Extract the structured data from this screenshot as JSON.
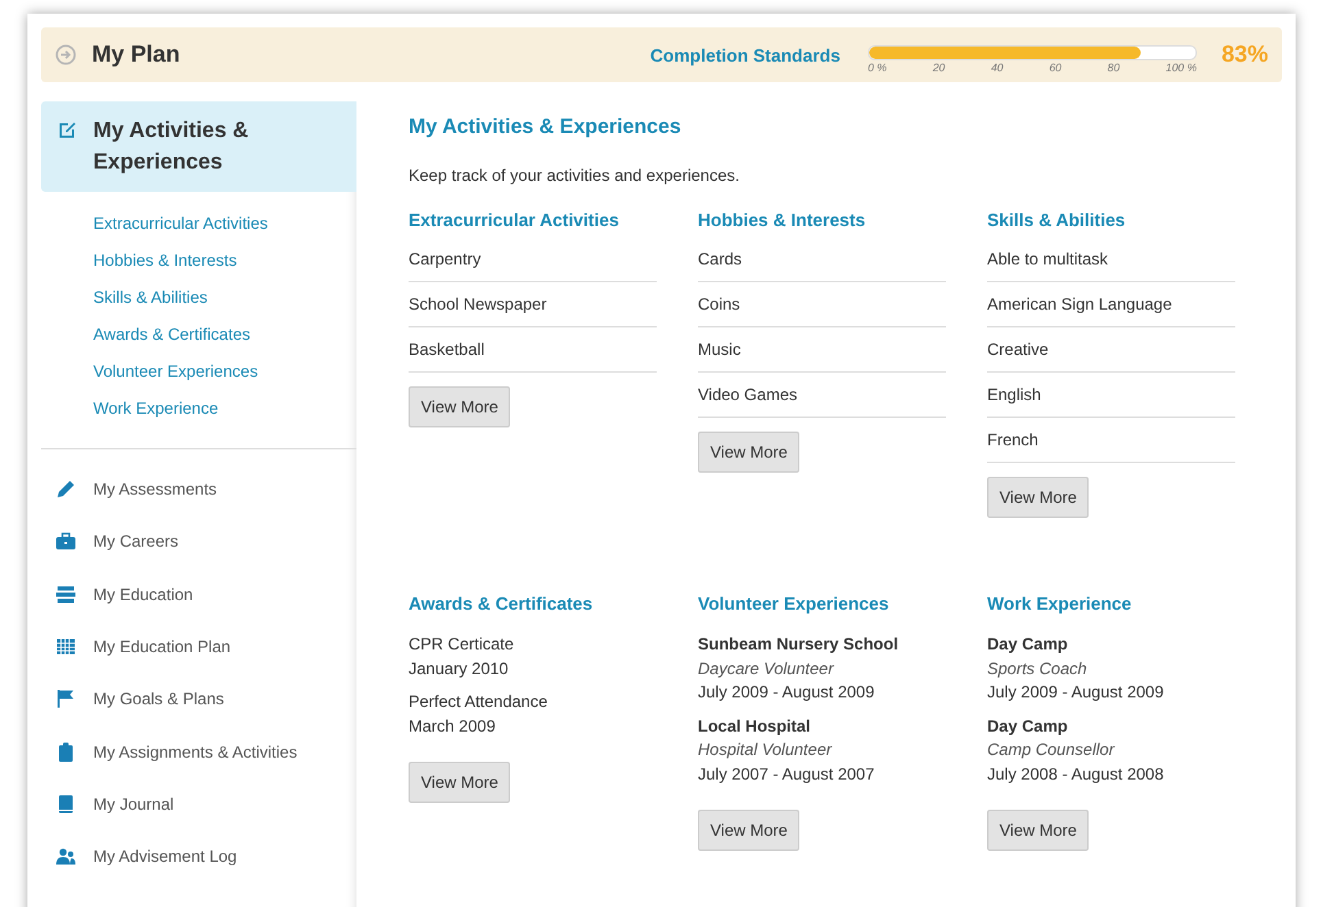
{
  "header": {
    "title": "My Plan",
    "progress_label": "Completion Standards",
    "progress": {
      "level": 0.83,
      "ticks": [
        "0 %",
        "20",
        "40",
        "60",
        "80",
        "100 %"
      ]
    },
    "percent": "83%"
  },
  "sidebar": {
    "active": {
      "label": "My Activities & Experiences",
      "selected": true
    },
    "subitems": [
      "Extracurricular Activities",
      "Hobbies & Interests",
      "Skills & Abilities",
      "Awards & Certificates",
      "Volunteer Experiences",
      "Work Experience"
    ],
    "items": [
      "My Assessments",
      "My Careers",
      "My Education",
      "My Education Plan",
      "My Goals & Plans",
      "My Assignments & Activities",
      "My Journal",
      "My Advisement Log"
    ]
  },
  "main": {
    "title": "My Activities & Experiences",
    "intro": "Keep track of your activities and experiences.",
    "sections": [
      {
        "kind": "list",
        "title": "Extracurricular Activities",
        "items": [
          "Carpentry",
          "School Newspaper",
          "Basketball"
        ],
        "button": "View More"
      },
      {
        "kind": "list",
        "title": "Hobbies & Interests",
        "items": [
          "Cards",
          "Coins",
          "Music",
          "Video Games"
        ],
        "button": "View More"
      },
      {
        "kind": "list",
        "title": "Skills & Abilities",
        "items": [
          "Able to multitask",
          "American Sign Language",
          "Creative",
          "English",
          "French"
        ],
        "button": "View More"
      },
      {
        "kind": "awards",
        "title": "Awards & Certificates",
        "entries": [
          {
            "name": "CPR Certicate",
            "date": "January 2010"
          },
          {
            "name": "Perfect Attendance",
            "date": "March 2009"
          }
        ],
        "button": "View More"
      },
      {
        "kind": "experience",
        "title": "Volunteer Experiences",
        "entries": [
          {
            "org": "Sunbeam Nursery School",
            "role": "Daycare Volunteer",
            "dates": "July 2009 - August 2009"
          },
          {
            "org": "Local Hospital",
            "role": "Hospital Volunteer",
            "dates": "July 2007 - August 2007"
          }
        ],
        "button": "View More"
      },
      {
        "kind": "experience",
        "title": "Work Experience",
        "entries": [
          {
            "org": "Day Camp",
            "role": "Sports Coach",
            "dates": "July 2009 - August 2009"
          },
          {
            "org": "Day Camp",
            "role": "Camp Counsellor",
            "dates": "July 2008 - August 2008"
          }
        ],
        "button": "View More"
      }
    ]
  }
}
